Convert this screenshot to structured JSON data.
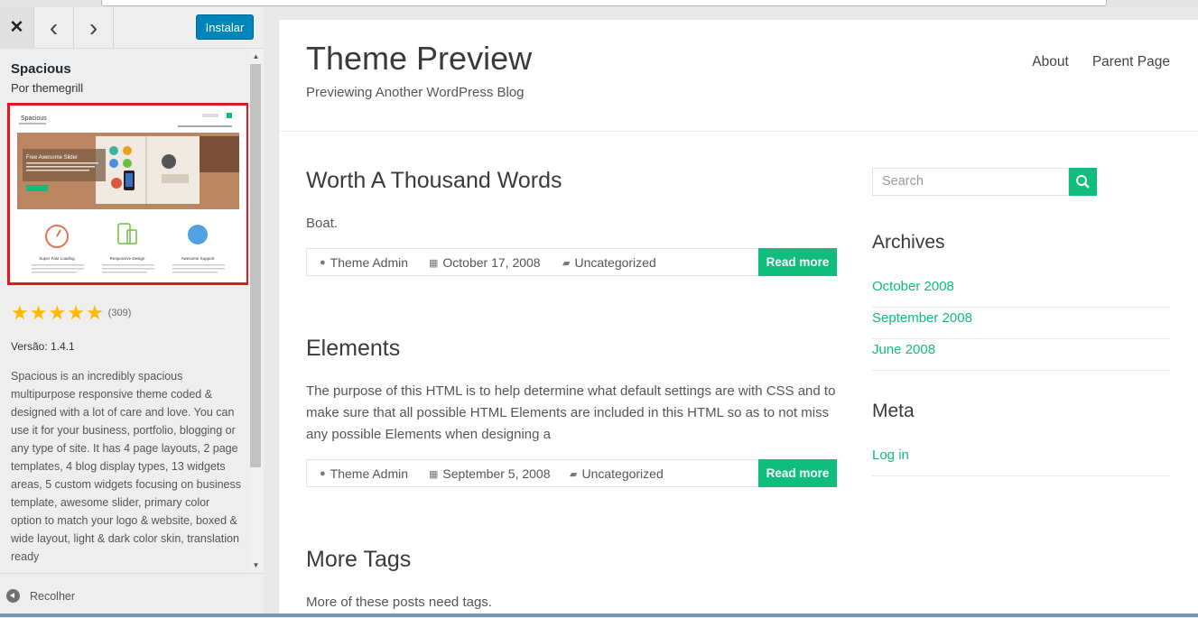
{
  "sidebar": {
    "close_glyph": "✕",
    "prev_glyph": "‹",
    "next_glyph": "›",
    "install_label": "Instalar",
    "theme_name": "Spacious",
    "theme_author": "Por themegrill",
    "rating_stars": 5,
    "rating_count": "(309)",
    "version": "Versão: 1.4.1",
    "description": "Spacious is an incredibly spacious multipurpose responsive theme coded & designed with a lot of care and love. You can use it for your business, portfolio, blogging or any type of site. It has 4 page layouts, 2 page templates, 4 blog display types, 13 widgets areas, 5 custom widgets focusing on business template, awesome slider, primary color option to match your logo & website, boxed & wide layout, light & dark color skin, translation ready",
    "collapse_label": "Recolher",
    "thumbnail": {
      "site_title": "Spacious",
      "slider_title": "Free Awesome Slider",
      "features": [
        "Super Fast Loading",
        "Responsive Design",
        "Awesome Support"
      ]
    }
  },
  "preview": {
    "site_title": "Theme Preview",
    "site_description": "Previewing Another WordPress Blog",
    "nav": [
      "About",
      "Parent Page"
    ],
    "posts": [
      {
        "title": "Worth A Thousand Words",
        "excerpt": "Boat.",
        "author": "Theme Admin",
        "date": "October 17, 2008",
        "category": "Uncategorized",
        "read_more": "Read more"
      },
      {
        "title": "Elements",
        "excerpt": "The purpose of this HTML is to help determine what default settings are with CSS and to make sure that all possible HTML Elements are included in this HTML so as to not miss any possible Elements when designing a",
        "author": "Theme Admin",
        "date": "September 5, 2008",
        "category": "Uncategorized",
        "read_more": "Read more"
      },
      {
        "title": "More Tags",
        "excerpt": "More of these posts need tags."
      }
    ],
    "search_placeholder": "Search",
    "archives_title": "Archives",
    "archives": [
      "October 2008",
      "September 2008",
      "June 2008"
    ],
    "meta_title": "Meta",
    "meta_links": [
      "Log in"
    ]
  },
  "colors": {
    "accent": "#0fbe7c",
    "install_button": "#0085ba",
    "highlight_border": "#e4151f",
    "star": "#ffb900"
  }
}
